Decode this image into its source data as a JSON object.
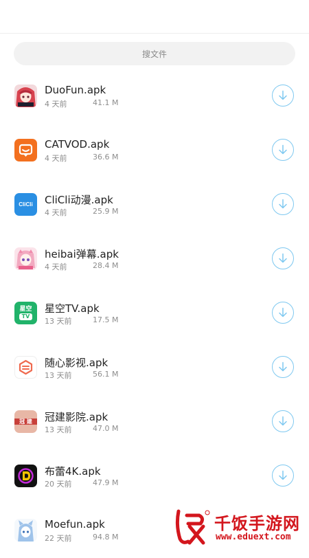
{
  "search": {
    "placeholder": "搜文件"
  },
  "files": [
    {
      "name": "DuoFun.apk",
      "time": "4 天前",
      "size": "41.1 M",
      "icon": "anime-girl-icon",
      "color": "#c83a52"
    },
    {
      "name": "CATVOD.apk",
      "time": "4 天前",
      "size": "36.6 M",
      "icon": "catvod-icon",
      "color": "#f3701f"
    },
    {
      "name": "CliCli动漫.apk",
      "time": "4 天前",
      "size": "25.9 M",
      "icon": "clicli-icon",
      "color": "#2a8fe3"
    },
    {
      "name": "heibai弹幕.apk",
      "time": "4 天前",
      "size": "28.4 M",
      "icon": "heibai-icon",
      "color": "#f6b7c8"
    },
    {
      "name": "星空TV.apk",
      "time": "13 天前",
      "size": "17.5 M",
      "icon": "xingkong-tv-icon",
      "color": "#21b36a"
    },
    {
      "name": "随心影视.apk",
      "time": "13 天前",
      "size": "56.1 M",
      "icon": "suixin-icon",
      "color": "#ef6a4f"
    },
    {
      "name": "冠建影院.apk",
      "time": "13 天前",
      "size": "47.0 M",
      "icon": "guanjian-icon",
      "color": "#e8b7a6"
    },
    {
      "name": "布蕾4K.apk",
      "time": "20 天前",
      "size": "47.9 M",
      "icon": "bulei-4k-icon",
      "color": "#111111"
    },
    {
      "name": "Moefun.apk",
      "time": "22 天前",
      "size": "94.8 M",
      "icon": "moefun-icon",
      "color": "#9fc3ea"
    }
  ],
  "icon_texts": {
    "clicli": "CliCli",
    "xingkong": "星空",
    "xingkong_tv": "TV",
    "guanjian": "冠 建"
  },
  "watermark": {
    "cn": "千饭手游网",
    "url": "www.eduext.com"
  },
  "accent": "#7ec8f0"
}
